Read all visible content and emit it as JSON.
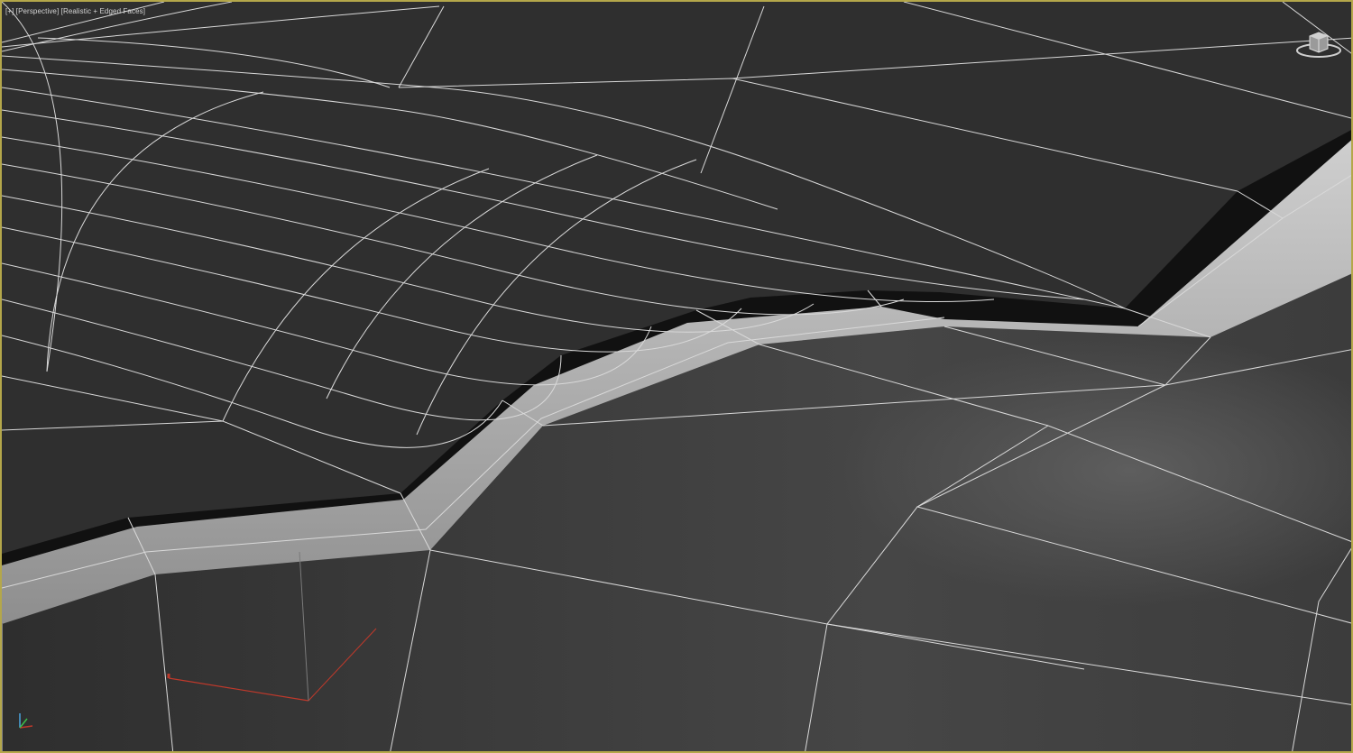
{
  "viewport": {
    "menu_label": "[+]",
    "view_label": "[Perspective]",
    "shading_label": "[Realistic + Edged Faces]"
  },
  "colors": {
    "active_border": "#b4a74a",
    "background": "#303030",
    "wire": "#d9d9d9",
    "bevel_light": "#b8b8b8",
    "bevel_dark": "#111111",
    "axis_x": "#c0392b"
  },
  "icons": {
    "viewcube": "viewcube-icon",
    "axis_tripod": "axis-tripod-icon",
    "gizmo": "transform-gizmo-icon"
  }
}
